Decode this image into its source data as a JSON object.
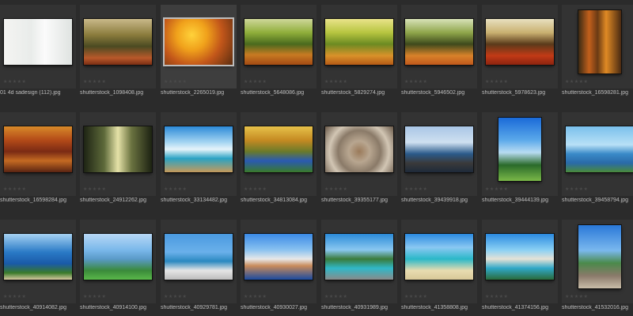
{
  "browser": {
    "rows": [
      [
        {
          "filename": "01 4d sadesign (112).jpg",
          "rating": "★★★★★",
          "orientation": "land",
          "scene": "white-window",
          "selected": false
        },
        {
          "filename": "shutterstock_1098408.jpg",
          "rating": "★★★★★",
          "orientation": "land",
          "scene": "autumn-park",
          "selected": false
        },
        {
          "filename": "shutterstock_2265019.jpg",
          "rating": "★★★★★",
          "orientation": "land",
          "scene": "autumn-branches",
          "selected": true
        },
        {
          "filename": "shutterstock_5648086.jpg",
          "rating": "★★★★★",
          "orientation": "land",
          "scene": "autumn-trees",
          "selected": false
        },
        {
          "filename": "shutterstock_5829274.jpg",
          "rating": "★★★★★",
          "orientation": "land",
          "scene": "autumn-sunny",
          "selected": false
        },
        {
          "filename": "shutterstock_5946502.jpg",
          "rating": "★★★★★",
          "orientation": "land",
          "scene": "autumn-forest",
          "selected": false
        },
        {
          "filename": "shutterstock_5978623.jpg",
          "rating": "★★★★★",
          "orientation": "land",
          "scene": "autumn-red",
          "selected": false
        },
        {
          "filename": "shutterstock_16598281.jpg",
          "rating": "★★★★★",
          "orientation": "port",
          "scene": "autumn-tall",
          "selected": false
        }
      ],
      [
        {
          "filename": "shutterstock_16598284.jpg",
          "rating": "★★★★★",
          "orientation": "land",
          "scene": "autumn-lake",
          "selected": false
        },
        {
          "filename": "shutterstock_24912262.jpg",
          "rating": "★★★★★",
          "orientation": "land",
          "scene": "misty-forest",
          "selected": false
        },
        {
          "filename": "shutterstock_33134482.jpg",
          "rating": "★★★★★",
          "orientation": "land",
          "scene": "pier-sky",
          "selected": false
        },
        {
          "filename": "shutterstock_34813084.jpg",
          "rating": "★★★★★",
          "orientation": "land",
          "scene": "autumn-river",
          "selected": false
        },
        {
          "filename": "shutterstock_39355177.jpg",
          "rating": "★★★★★",
          "orientation": "land",
          "scene": "stones",
          "selected": false
        },
        {
          "filename": "shutterstock_39439918.jpg",
          "rating": "★★★★★",
          "orientation": "land",
          "scene": "gulls-pier",
          "selected": false
        },
        {
          "filename": "shutterstock_39444139.jpg",
          "rating": "★★★★★",
          "orientation": "port",
          "scene": "palm-beach",
          "selected": false
        },
        {
          "filename": "shutterstock_39458794.jpg",
          "rating": "★★★★★",
          "orientation": "land",
          "scene": "palm-sea",
          "selected": false
        }
      ],
      [
        {
          "filename": "shutterstock_40914082.jpg",
          "rating": "★★★★★",
          "orientation": "land",
          "scene": "coast-cliff",
          "selected": false
        },
        {
          "filename": "shutterstock_40914100.jpg",
          "rating": "★★★★★",
          "orientation": "land",
          "scene": "green-coast",
          "selected": false
        },
        {
          "filename": "shutterstock_40929781.jpg",
          "rating": "★★★★★",
          "orientation": "land",
          "scene": "beach-chairs",
          "selected": false
        },
        {
          "filename": "shutterstock_40930027.jpg",
          "rating": "★★★★★",
          "orientation": "land",
          "scene": "blue-town",
          "selected": false
        },
        {
          "filename": "shutterstock_40931989.jpg",
          "rating": "★★★★★",
          "orientation": "land",
          "scene": "palm-rocks",
          "selected": false
        },
        {
          "filename": "shutterstock_41358808.jpg",
          "rating": "★★★★★",
          "orientation": "land",
          "scene": "tropic-beach",
          "selected": false
        },
        {
          "filename": "shutterstock_41374156.jpg",
          "rating": "★★★★★",
          "orientation": "land",
          "scene": "sea-arch",
          "selected": false
        },
        {
          "filename": "shutterstock_41532016.jpg",
          "rating": "★★★★★",
          "orientation": "port",
          "scene": "rocky-shore",
          "selected": false
        }
      ]
    ]
  }
}
